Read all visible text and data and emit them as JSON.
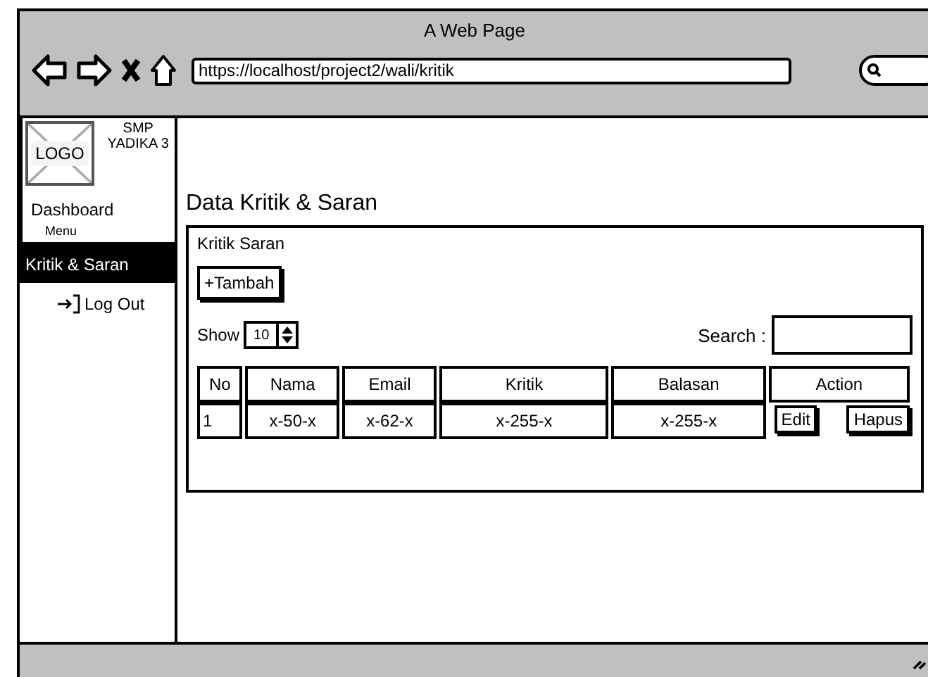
{
  "window": {
    "title": "A Web Page",
    "url": "https://localhost/project2/wali/kritik"
  },
  "sidebar": {
    "logo": "LOGO",
    "school": [
      "SMP",
      "YADIKA 3"
    ],
    "items": [
      {
        "label": "Dashboard",
        "kind": "link",
        "selected": false
      },
      {
        "label": "Menu",
        "kind": "heading",
        "selected": false
      },
      {
        "label": "Kritik & Saran",
        "kind": "link",
        "selected": true
      },
      {
        "label": "Log Out",
        "kind": "logout",
        "selected": false
      }
    ]
  },
  "page_title": "Data Kritik & Saran",
  "panel": {
    "title": "Kritik Saran",
    "add_button": "+Tambah",
    "show_label": "Show",
    "page_size": "10",
    "search_label": "Search :",
    "table": {
      "columns": [
        "No",
        "Nama",
        "Email",
        "Kritik",
        "Balasan",
        "Action"
      ],
      "rows": [
        {
          "cells": [
            "1",
            "x-50-x",
            "x-62-x",
            "x-255-x",
            "x-255-x"
          ],
          "actions": [
            "Edit",
            "Hapus"
          ]
        }
      ]
    }
  }
}
